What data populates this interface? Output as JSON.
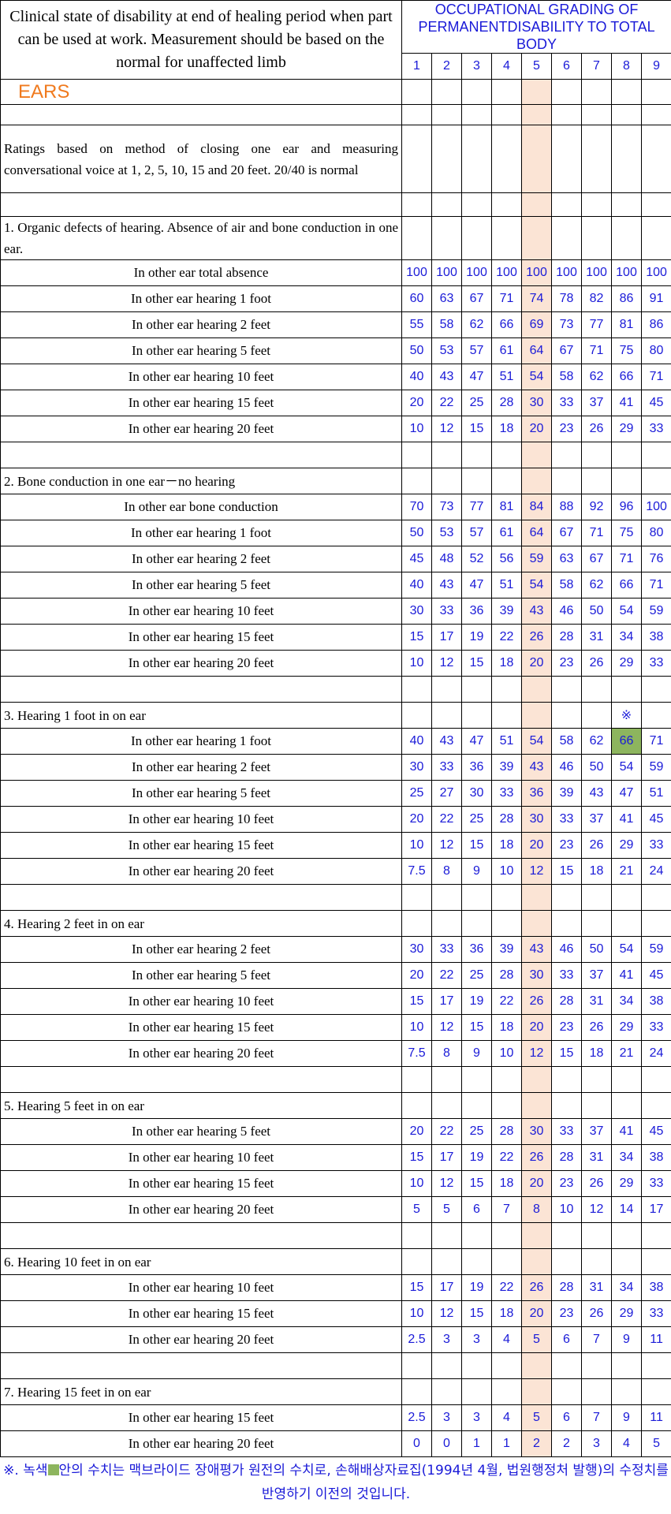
{
  "header": {
    "description": "Clinical  state of disability at end of healing period when part can be used at work. Measurement should be based on the normal for unaffected limb",
    "grading_title": "OCCUPATIONAL GRADING OF PERMANENTDISABILITY TO TOTAL BODY",
    "columns": [
      "1",
      "2",
      "3",
      "4",
      "5",
      "6",
      "7",
      "8",
      "9"
    ]
  },
  "section_title": "EARS",
  "intro": "Ratings based on method of closing one ear and measuring  conversational voice at 1, 2, 5, 10, 15 and 20 feet. 20/40 is normal",
  "groups": [
    {
      "title": "1. Organic defects of hearing. Absence of air and bone conduction in one ear.",
      "rows": [
        {
          "label": "In other ear total absence",
          "values": [
            "100",
            "100",
            "100",
            "100",
            "100",
            "100",
            "100",
            "100",
            "100"
          ]
        },
        {
          "label": "In other ear hearing 1 foot",
          "values": [
            "60",
            "63",
            "67",
            "71",
            "74",
            "78",
            "82",
            "86",
            "91"
          ]
        },
        {
          "label": "In other ear hearing 2 feet",
          "values": [
            "55",
            "58",
            "62",
            "66",
            "69",
            "73",
            "77",
            "81",
            "86"
          ]
        },
        {
          "label": "In other ear hearing 5 feet",
          "values": [
            "50",
            "53",
            "57",
            "61",
            "64",
            "67",
            "71",
            "75",
            "80"
          ]
        },
        {
          "label": "In other ear hearing 10 feet",
          "values": [
            "40",
            "43",
            "47",
            "51",
            "54",
            "58",
            "62",
            "66",
            "71"
          ]
        },
        {
          "label": "In other ear hearing 15 feet",
          "values": [
            "20",
            "22",
            "25",
            "28",
            "30",
            "33",
            "37",
            "41",
            "45"
          ]
        },
        {
          "label": "In other ear hearing 20 feet",
          "values": [
            "10",
            "12",
            "15",
            "18",
            "20",
            "23",
            "26",
            "29",
            "33"
          ]
        }
      ]
    },
    {
      "title": "2. Bone conduction in one ear－no hearing",
      "rows": [
        {
          "label": "In other ear bone conduction",
          "values": [
            "70",
            "73",
            "77",
            "81",
            "84",
            "88",
            "92",
            "96",
            "100"
          ]
        },
        {
          "label": "In other ear hearing 1 foot",
          "values": [
            "50",
            "53",
            "57",
            "61",
            "64",
            "67",
            "71",
            "75",
            "80"
          ]
        },
        {
          "label": "In other ear hearing 2 feet",
          "values": [
            "45",
            "48",
            "52",
            "56",
            "59",
            "63",
            "67",
            "71",
            "76"
          ]
        },
        {
          "label": "In other ear hearing 5 feet",
          "values": [
            "40",
            "43",
            "47",
            "51",
            "54",
            "58",
            "62",
            "66",
            "71"
          ]
        },
        {
          "label": "In other ear hearing 10 feet",
          "values": [
            "30",
            "33",
            "36",
            "39",
            "43",
            "46",
            "50",
            "54",
            "59"
          ]
        },
        {
          "label": "In other ear hearing 15 feet",
          "values": [
            "15",
            "17",
            "19",
            "22",
            "26",
            "28",
            "31",
            "34",
            "38"
          ]
        },
        {
          "label": "In other ear hearing 20 feet",
          "values": [
            "10",
            "12",
            "15",
            "18",
            "20",
            "23",
            "26",
            "29",
            "33"
          ]
        }
      ]
    },
    {
      "title": "3. Hearing 1 foot in on ear",
      "title_mark": "※",
      "rows": [
        {
          "label": "In other ear hearing 1 foot",
          "values": [
            "40",
            "43",
            "47",
            "51",
            "54",
            "58",
            "62",
            "66",
            "71"
          ]
        },
        {
          "label": "In other ear hearing 2 feet",
          "values": [
            "30",
            "33",
            "36",
            "39",
            "43",
            "46",
            "50",
            "54",
            "59"
          ]
        },
        {
          "label": "In other ear hearing 5 feet",
          "values": [
            "25",
            "27",
            "30",
            "33",
            "36",
            "39",
            "43",
            "47",
            "51"
          ]
        },
        {
          "label": "In other ear hearing 10 feet",
          "values": [
            "20",
            "22",
            "25",
            "28",
            "30",
            "33",
            "37",
            "41",
            "45"
          ]
        },
        {
          "label": "In other ear hearing 15 feet",
          "values": [
            "10",
            "12",
            "15",
            "18",
            "20",
            "23",
            "26",
            "29",
            "33"
          ]
        },
        {
          "label": "In other ear hearing 20 feet",
          "values": [
            "7.5",
            "8",
            "9",
            "10",
            "12",
            "15",
            "18",
            "21",
            "24"
          ]
        }
      ]
    },
    {
      "title": "4. Hearing 2 feet in on ear",
      "rows": [
        {
          "label": "In other ear hearing 2 feet",
          "values": [
            "30",
            "33",
            "36",
            "39",
            "43",
            "46",
            "50",
            "54",
            "59"
          ]
        },
        {
          "label": "In other ear hearing 5 feet",
          "values": [
            "20",
            "22",
            "25",
            "28",
            "30",
            "33",
            "37",
            "41",
            "45"
          ]
        },
        {
          "label": "In other ear hearing 10 feet",
          "values": [
            "15",
            "17",
            "19",
            "22",
            "26",
            "28",
            "31",
            "34",
            "38"
          ]
        },
        {
          "label": "In other ear hearing 15 feet",
          "values": [
            "10",
            "12",
            "15",
            "18",
            "20",
            "23",
            "26",
            "29",
            "33"
          ]
        },
        {
          "label": "In other ear hearing 20 feet",
          "values": [
            "7.5",
            "8",
            "9",
            "10",
            "12",
            "15",
            "18",
            "21",
            "24"
          ]
        }
      ]
    },
    {
      "title": "5. Hearing 5 feet in on ear",
      "rows": [
        {
          "label": "In other ear hearing 5 feet",
          "values": [
            "20",
            "22",
            "25",
            "28",
            "30",
            "33",
            "37",
            "41",
            "45"
          ]
        },
        {
          "label": "In other ear hearing 10 feet",
          "values": [
            "15",
            "17",
            "19",
            "22",
            "26",
            "28",
            "31",
            "34",
            "38"
          ]
        },
        {
          "label": "In other ear hearing 15 feet",
          "values": [
            "10",
            "12",
            "15",
            "18",
            "20",
            "23",
            "26",
            "29",
            "33"
          ]
        },
        {
          "label": "In other ear hearing 20 feet",
          "values": [
            "5",
            "5",
            "6",
            "7",
            "8",
            "10",
            "12",
            "14",
            "17"
          ]
        }
      ]
    },
    {
      "title": "6. Hearing 10 feet in on ear",
      "rows": [
        {
          "label": "In other ear hearing 10 feet",
          "values": [
            "15",
            "17",
            "19",
            "22",
            "26",
            "28",
            "31",
            "34",
            "38"
          ]
        },
        {
          "label": "In other ear hearing 15 feet",
          "values": [
            "10",
            "12",
            "15",
            "18",
            "20",
            "23",
            "26",
            "29",
            "33"
          ]
        },
        {
          "label": "In other ear hearing 20 feet",
          "values": [
            "2.5",
            "3",
            "3",
            "4",
            "5",
            "6",
            "7",
            "9",
            "11"
          ]
        }
      ]
    },
    {
      "title": "7. Hearing 15 feet in on ear",
      "rows": [
        {
          "label": "In other ear hearing 15 feet",
          "values": [
            "2.5",
            "3",
            "3",
            "4",
            "5",
            "6",
            "7",
            "9",
            "11"
          ]
        },
        {
          "label": "In other ear hearing 20 feet",
          "values": [
            "0",
            "0",
            "1",
            "1",
            "2",
            "2",
            "3",
            "4",
            "5"
          ]
        }
      ]
    }
  ],
  "footnote_prefix": "※. 녹색",
  "footnote_rest": "안의 수치는 맥브라이드 장애평가 원전의 수치로, 손해배상자료집(1994년 4월, 법원행정처 발행)의 수정치를 반영하기 이전의 것입니다.",
  "colors": {
    "text_blue": "#1a1ad8",
    "section_orange": "#f07a1e",
    "column5_fill": "#fbe4d5",
    "highlight_green": "#8db55e"
  }
}
